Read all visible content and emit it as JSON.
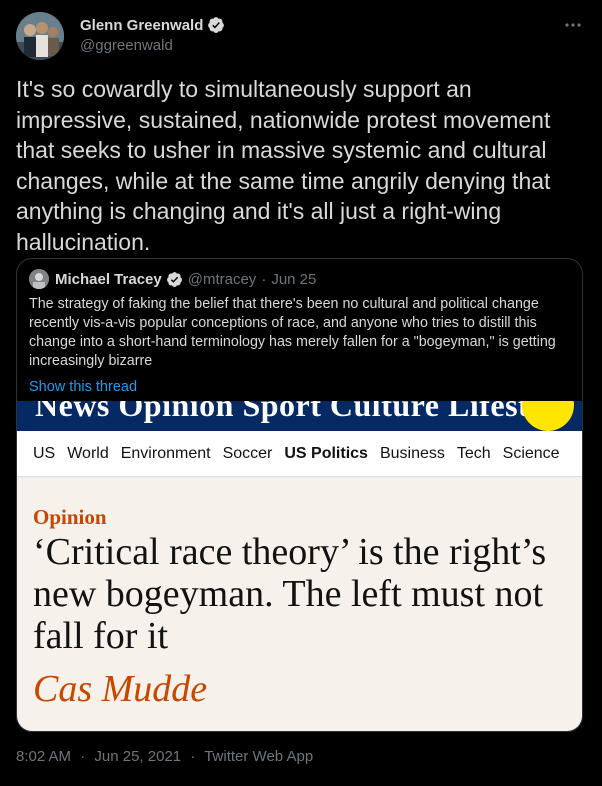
{
  "author": {
    "display_name": "Glenn Greenwald",
    "handle": "@ggreenwald",
    "verified_icon": "verified-badge-icon"
  },
  "tweet": {
    "text": "It's so cowardly to simultaneously support an impressive, sustained, nationwide protest movement that seeks to usher in massive systemic and cultural changes, while at the same time angrily denying that anything is changing and it's all just a right-wing hallucination."
  },
  "quoted": {
    "display_name": "Michael Tracey",
    "handle": "@mtracey",
    "separator": "·",
    "date": "Jun 25",
    "text": "The strategy of faking the belief that there's been no cultural and political change recently vis-a-vis popular conceptions of race, and anyone who tries to distill this change into a short-hand terminology has merely fallen for a \"bogeyman,\" is getting increasingly bizarre",
    "show_thread": "Show this thread"
  },
  "article": {
    "top_nav_text": "News Opinion Sport Culture Lifestyle",
    "subnav": [
      {
        "label": "US",
        "active": false
      },
      {
        "label": "World",
        "active": false
      },
      {
        "label": "Environment",
        "active": false
      },
      {
        "label": "Soccer",
        "active": false
      },
      {
        "label": "US Politics",
        "active": true
      },
      {
        "label": "Business",
        "active": false
      },
      {
        "label": "Tech",
        "active": false
      },
      {
        "label": "Science",
        "active": false
      }
    ],
    "kicker": "Opinion",
    "headline": "‘Critical race theory’ is the right’s new bogeyman. The left must not fall for it",
    "byline": "Cas Mudde"
  },
  "footer": {
    "time": "8:02 AM",
    "separator1": "·",
    "date": "Jun 25, 2021",
    "separator2": "·",
    "app": "Twitter Web App"
  },
  "colors": {
    "background": "#000000",
    "text": "#d9d9d9",
    "muted": "#6e767d",
    "link": "#1d9bf0",
    "guardian_blue": "#052962",
    "guardian_orange": "#c74600",
    "guardian_yellow": "#ffe500"
  }
}
